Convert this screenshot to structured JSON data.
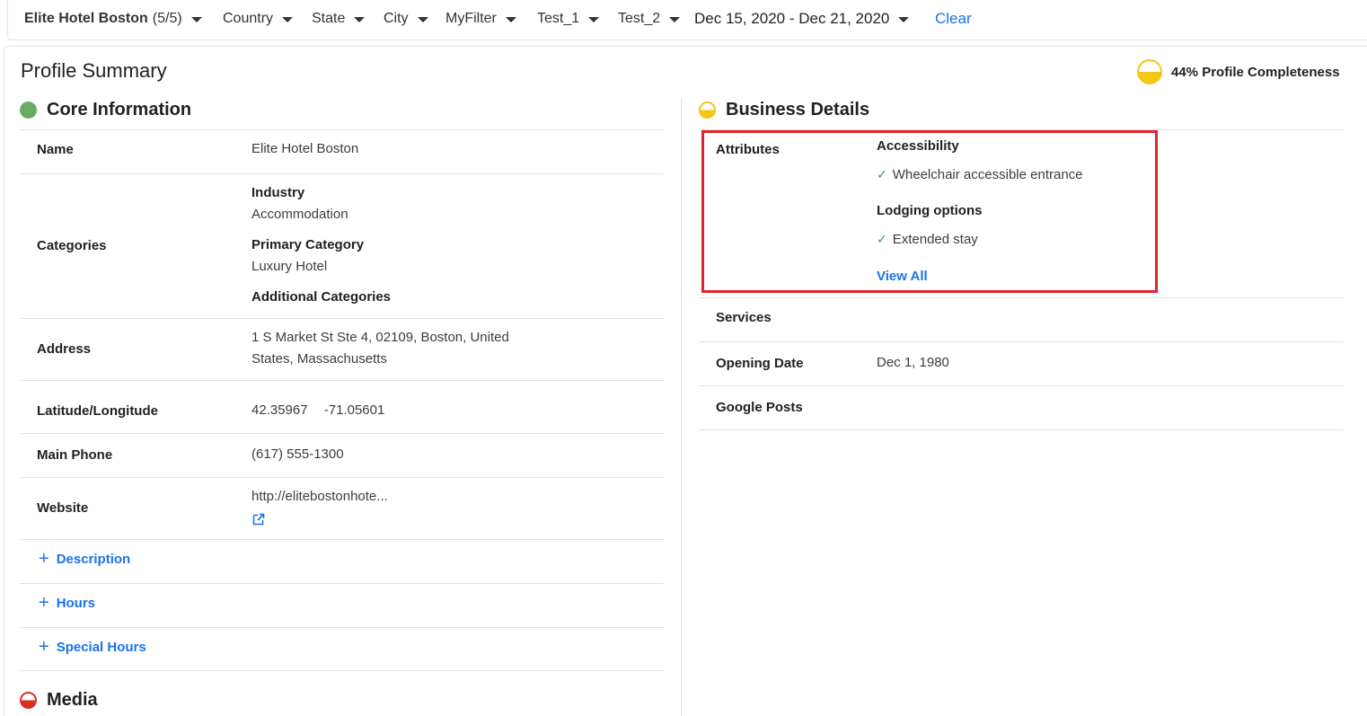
{
  "filters": {
    "location": {
      "name": "Elite Hotel Boston",
      "count": "(5/5)"
    },
    "country": "Country",
    "state": "State",
    "city": "City",
    "myfilter": "MyFilter",
    "test1": "Test_1",
    "test2": "Test_2",
    "date_range": "Dec 15, 2020 - Dec 21, 2020",
    "clear": "Clear"
  },
  "page_title": "Profile Summary",
  "completeness": {
    "label": "44% Profile Completeness",
    "percent": 44,
    "color": "#f5c518"
  },
  "core": {
    "title": "Core Information",
    "status_color": "#6aab62",
    "name": {
      "label": "Name",
      "value": "Elite Hotel Boston"
    },
    "categories": {
      "label": "Categories",
      "industry_label": "Industry",
      "industry_value": "Accommodation",
      "primary_label": "Primary Category",
      "primary_value": "Luxury Hotel",
      "additional_label": "Additional Categories"
    },
    "address": {
      "label": "Address",
      "line1": "1 S Market St Ste 4, 02109, Boston, United",
      "line2": "States, Massachusetts"
    },
    "latlng": {
      "label": "Latitude/Longitude",
      "lat": "42.35967",
      "lng": "-71.05601"
    },
    "phone": {
      "label": "Main Phone",
      "value": "(617) 555-1300"
    },
    "website": {
      "label": "Website",
      "value": "http://elitebostonhote..."
    },
    "add_links": {
      "description": "Description",
      "hours": "Hours",
      "special_hours": "Special Hours"
    }
  },
  "business": {
    "title": "Business Details",
    "status_color": "#f5c518",
    "attributes": {
      "label": "Attributes",
      "group1_title": "Accessibility",
      "group1_item": "Wheelchair accessible entrance",
      "group2_title": "Lodging options",
      "group2_item": "Extended stay",
      "view_all": "View All"
    },
    "services": {
      "label": "Services"
    },
    "opening_date": {
      "label": "Opening Date",
      "value": "Dec 1, 1980"
    },
    "google_posts": {
      "label": "Google Posts"
    }
  },
  "media": {
    "title": "Media",
    "status_color": "#d93025"
  },
  "icons": {
    "caret": "chevron-down-icon",
    "external": "external-link-icon",
    "plus": "plus-icon",
    "check": "check-icon"
  }
}
